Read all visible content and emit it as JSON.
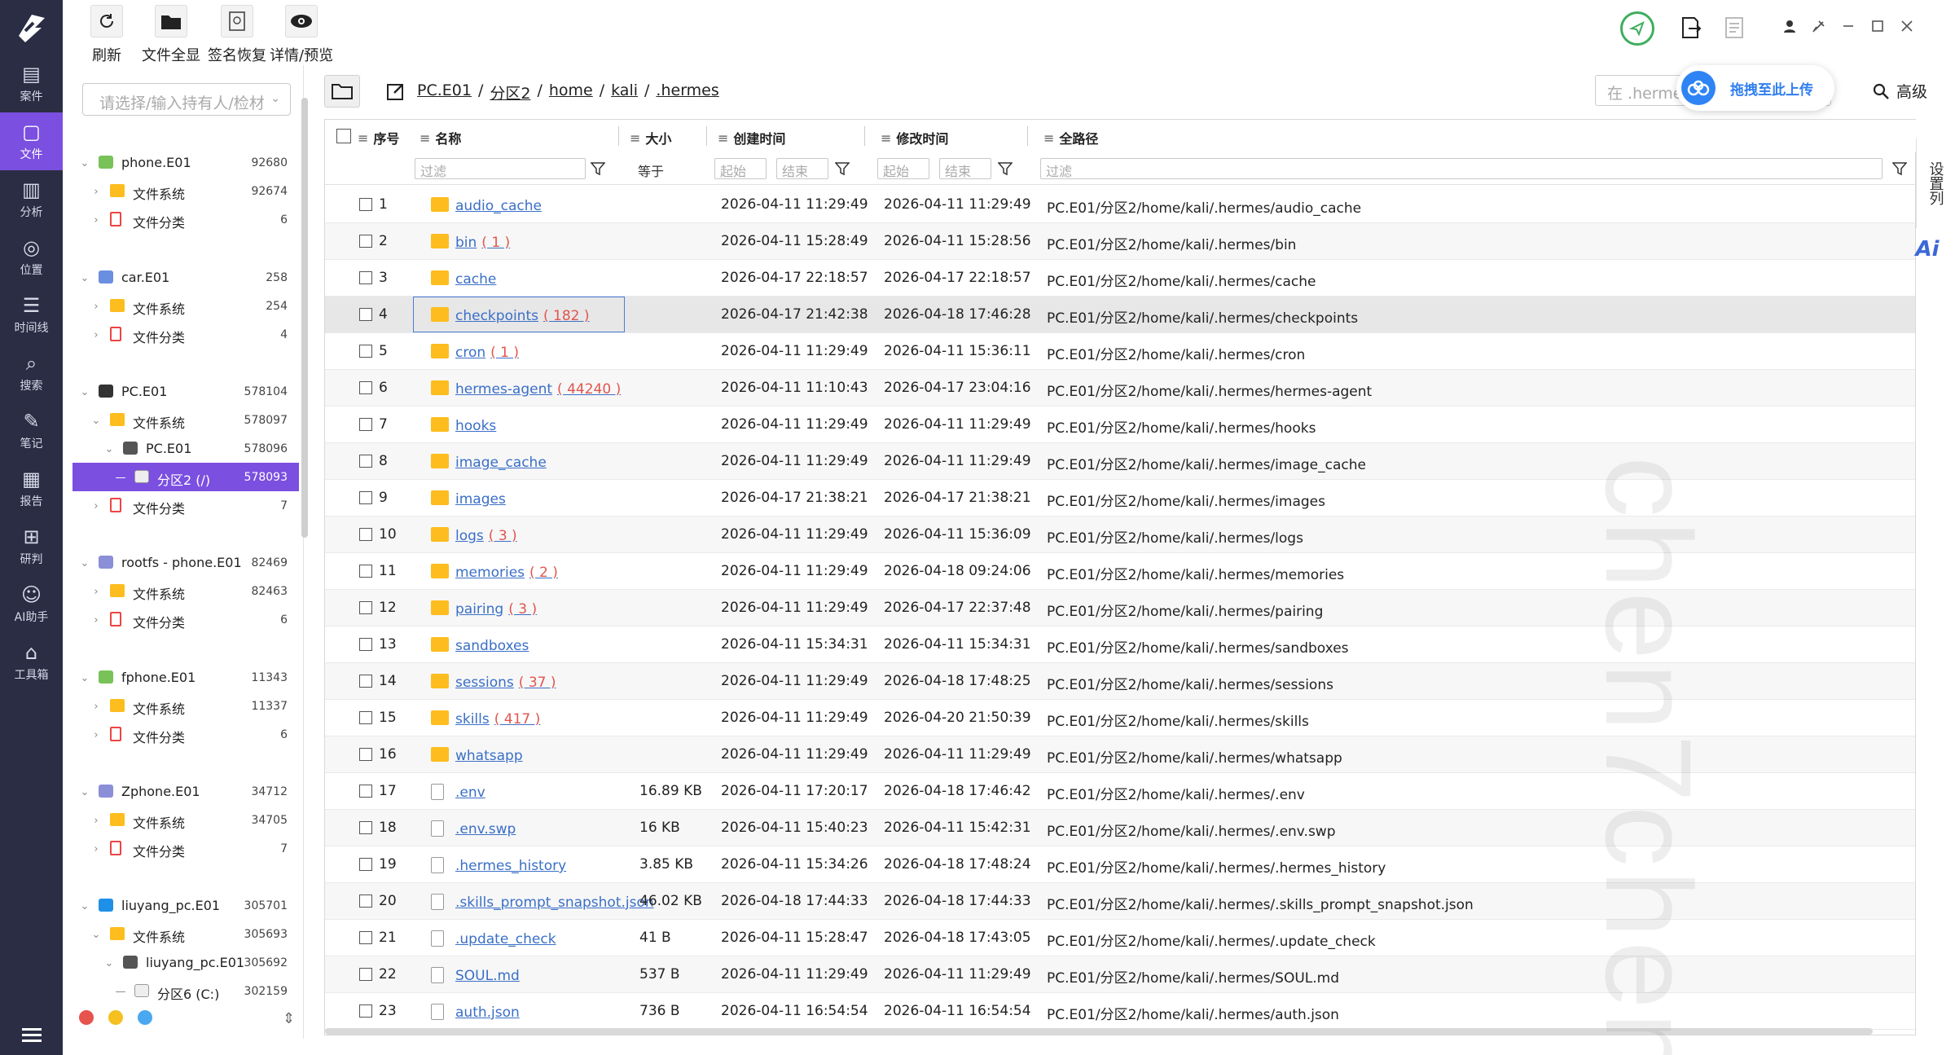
{
  "window_controls": [
    "pin-icon",
    "minimize",
    "maximize",
    "close"
  ],
  "toolbar": {
    "refresh": "刷新",
    "show_all": "文件全显",
    "sign_restore": "签名恢复",
    "detail_preview": "详情/预览"
  },
  "nav": {
    "items": [
      {
        "label": "案件",
        "icon": "case-icon"
      },
      {
        "label": "文件",
        "icon": "file-icon",
        "active": true
      },
      {
        "label": "分析",
        "icon": "analysis-icon"
      },
      {
        "label": "位置",
        "icon": "location-icon"
      },
      {
        "label": "时间线",
        "icon": "timeline-icon"
      },
      {
        "label": "搜索",
        "icon": "search-icon"
      },
      {
        "label": "笔记",
        "icon": "note-icon"
      },
      {
        "label": "报告",
        "icon": "report-icon"
      },
      {
        "label": "研判",
        "icon": "judge-icon"
      },
      {
        "label": "AI助手",
        "icon": "ai-assistant-icon"
      },
      {
        "label": "工具箱",
        "icon": "toolbox-icon"
      }
    ]
  },
  "case_select": {
    "placeholder": "请选择/输入持有人/检材"
  },
  "tree": [
    {
      "label": "phone.E01",
      "count": "92680",
      "level": 0,
      "icon": "android",
      "open": true
    },
    {
      "label": "文件系统",
      "count": "92674",
      "level": 1,
      "icon": "folder"
    },
    {
      "label": "文件分类",
      "count": "6",
      "level": 1,
      "icon": "doc"
    },
    {
      "label": "car.E01",
      "count": "258",
      "level": 0,
      "icon": "car",
      "open": true
    },
    {
      "label": "文件系统",
      "count": "254",
      "level": 1,
      "icon": "folder"
    },
    {
      "label": "文件分类",
      "count": "4",
      "level": 1,
      "icon": "doc"
    },
    {
      "label": "PC.E01",
      "count": "578104",
      "level": 0,
      "icon": "linux",
      "open": true
    },
    {
      "label": "文件系统",
      "count": "578097",
      "level": 1,
      "icon": "folder",
      "open": true
    },
    {
      "label": "PC.E01",
      "count": "578096",
      "level": 2,
      "icon": "disk",
      "open": true
    },
    {
      "label": "分区2 (/)",
      "count": "578093",
      "level": 3,
      "icon": "partition",
      "selected": true
    },
    {
      "label": "文件分类",
      "count": "7",
      "level": 1,
      "icon": "doc"
    },
    {
      "label": "rootfs - phone.E01",
      "count": "82469",
      "level": 0,
      "icon": "rootfs",
      "open": true
    },
    {
      "label": "文件系统",
      "count": "82463",
      "level": 1,
      "icon": "folder"
    },
    {
      "label": "文件分类",
      "count": "6",
      "level": 1,
      "icon": "doc"
    },
    {
      "label": "fphone.E01",
      "count": "11343",
      "level": 0,
      "icon": "android",
      "open": true
    },
    {
      "label": "文件系统",
      "count": "11337",
      "level": 1,
      "icon": "folder"
    },
    {
      "label": "文件分类",
      "count": "6",
      "level": 1,
      "icon": "doc"
    },
    {
      "label": "Zphone.E01",
      "count": "34712",
      "level": 0,
      "icon": "zphone",
      "open": true
    },
    {
      "label": "文件系统",
      "count": "34705",
      "level": 1,
      "icon": "folder"
    },
    {
      "label": "文件分类",
      "count": "7",
      "level": 1,
      "icon": "doc"
    },
    {
      "label": "liuyang_pc.E01",
      "count": "305701",
      "level": 0,
      "icon": "windows",
      "open": true
    },
    {
      "label": "文件系统",
      "count": "305693",
      "level": 1,
      "icon": "folder",
      "open": true
    },
    {
      "label": "liuyang_pc.E01",
      "count": "305692",
      "level": 2,
      "icon": "disk",
      "open": true
    },
    {
      "label": "分区6 (C:)",
      "count": "302159",
      "level": 3,
      "icon": "partition"
    }
  ],
  "path": {
    "segments": [
      "PC.E01",
      "分区2",
      "home",
      "kali",
      ".hermes"
    ],
    "separator": "/"
  },
  "search": {
    "placeholder": "在 .hermes"
  },
  "upload": {
    "label": "拖拽至此上传"
  },
  "advanced": {
    "label": "高级"
  },
  "right_rail": {
    "settings_label": "设置列",
    "ai_label": "Ai"
  },
  "table": {
    "headers": {
      "index": "序号",
      "name": "名称",
      "size": "大小",
      "created": "创建时间",
      "modified": "修改时间",
      "fullpath": "全路径"
    },
    "filters": {
      "name": "过滤",
      "size": "等于",
      "start": "起始",
      "end": "结束",
      "path": "过滤"
    },
    "rows": [
      {
        "no": "1",
        "name": "audio_cache",
        "count": "",
        "type": "folder",
        "size": "",
        "created": "2026-04-11 11:29:49",
        "modified": "2026-04-11 11:29:49",
        "path": "PC.E01/分区2/home/kali/.hermes/audio_cache"
      },
      {
        "no": "2",
        "name": "bin",
        "count": "( 1 )",
        "type": "folder",
        "size": "",
        "created": "2026-04-11 15:28:49",
        "modified": "2026-04-11 15:28:56",
        "path": "PC.E01/分区2/home/kali/.hermes/bin"
      },
      {
        "no": "3",
        "name": "cache",
        "count": "",
        "type": "folder",
        "size": "",
        "created": "2026-04-17 22:18:57",
        "modified": "2026-04-17 22:18:57",
        "path": "PC.E01/分区2/home/kali/.hermes/cache"
      },
      {
        "no": "4",
        "name": "checkpoints",
        "count": "( 182 )",
        "type": "folder",
        "size": "",
        "created": "2026-04-17 21:42:38",
        "modified": "2026-04-18 17:46:28",
        "path": "PC.E01/分区2/home/kali/.hermes/checkpoints",
        "highlight": true
      },
      {
        "no": "5",
        "name": "cron",
        "count": "( 1 )",
        "type": "folder",
        "size": "",
        "created": "2026-04-11 11:29:49",
        "modified": "2026-04-11 15:36:11",
        "path": "PC.E01/分区2/home/kali/.hermes/cron"
      },
      {
        "no": "6",
        "name": "hermes-agent",
        "count": "( 44240 )",
        "type": "folder",
        "size": "",
        "created": "2026-04-11 11:10:43",
        "modified": "2026-04-17 23:04:16",
        "path": "PC.E01/分区2/home/kali/.hermes/hermes-agent"
      },
      {
        "no": "7",
        "name": "hooks",
        "count": "",
        "type": "folder",
        "size": "",
        "created": "2026-04-11 11:29:49",
        "modified": "2026-04-11 11:29:49",
        "path": "PC.E01/分区2/home/kali/.hermes/hooks"
      },
      {
        "no": "8",
        "name": "image_cache",
        "count": "",
        "type": "folder",
        "size": "",
        "created": "2026-04-11 11:29:49",
        "modified": "2026-04-11 11:29:49",
        "path": "PC.E01/分区2/home/kali/.hermes/image_cache"
      },
      {
        "no": "9",
        "name": "images",
        "count": "",
        "type": "folder",
        "size": "",
        "created": "2026-04-17 21:38:21",
        "modified": "2026-04-17 21:38:21",
        "path": "PC.E01/分区2/home/kali/.hermes/images"
      },
      {
        "no": "10",
        "name": "logs",
        "count": "( 3 )",
        "type": "folder",
        "size": "",
        "created": "2026-04-11 11:29:49",
        "modified": "2026-04-11 15:36:09",
        "path": "PC.E01/分区2/home/kali/.hermes/logs"
      },
      {
        "no": "11",
        "name": "memories",
        "count": "( 2 )",
        "type": "folder",
        "size": "",
        "created": "2026-04-11 11:29:49",
        "modified": "2026-04-18 09:24:06",
        "path": "PC.E01/分区2/home/kali/.hermes/memories"
      },
      {
        "no": "12",
        "name": "pairing",
        "count": "( 3 )",
        "type": "folder",
        "size": "",
        "created": "2026-04-11 11:29:49",
        "modified": "2026-04-17 22:37:48",
        "path": "PC.E01/分区2/home/kali/.hermes/pairing"
      },
      {
        "no": "13",
        "name": "sandboxes",
        "count": "",
        "type": "folder",
        "size": "",
        "created": "2026-04-11 15:34:31",
        "modified": "2026-04-11 15:34:31",
        "path": "PC.E01/分区2/home/kali/.hermes/sandboxes"
      },
      {
        "no": "14",
        "name": "sessions",
        "count": "( 37 )",
        "type": "folder",
        "size": "",
        "created": "2026-04-11 11:29:49",
        "modified": "2026-04-18 17:48:25",
        "path": "PC.E01/分区2/home/kali/.hermes/sessions"
      },
      {
        "no": "15",
        "name": "skills",
        "count": "( 417 )",
        "type": "folder",
        "size": "",
        "created": "2026-04-11 11:29:49",
        "modified": "2026-04-20 21:50:39",
        "path": "PC.E01/分区2/home/kali/.hermes/skills"
      },
      {
        "no": "16",
        "name": "whatsapp",
        "count": "",
        "type": "folder",
        "size": "",
        "created": "2026-04-11 11:29:49",
        "modified": "2026-04-11 11:29:49",
        "path": "PC.E01/分区2/home/kali/.hermes/whatsapp"
      },
      {
        "no": "17",
        "name": ".env",
        "count": "",
        "type": "file",
        "size": "16.89 KB",
        "created": "2026-04-11 17:20:17",
        "modified": "2026-04-18 17:46:42",
        "path": "PC.E01/分区2/home/kali/.hermes/.env"
      },
      {
        "no": "18",
        "name": ".env.swp",
        "count": "",
        "type": "file",
        "size": "16 KB",
        "created": "2026-04-11 15:40:23",
        "modified": "2026-04-11 15:42:31",
        "path": "PC.E01/分区2/home/kali/.hermes/.env.swp"
      },
      {
        "no": "19",
        "name": ".hermes_history",
        "count": "",
        "type": "file",
        "size": "3.85 KB",
        "created": "2026-04-11 15:34:26",
        "modified": "2026-04-18 17:48:24",
        "path": "PC.E01/分区2/home/kali/.hermes/.hermes_history"
      },
      {
        "no": "20",
        "name": ".skills_prompt_snapshot.json",
        "count": "",
        "type": "file",
        "size": "46.02 KB",
        "created": "2026-04-18 17:44:33",
        "modified": "2026-04-18 17:44:33",
        "path": "PC.E01/分区2/home/kali/.hermes/.skills_prompt_snapshot.json"
      },
      {
        "no": "21",
        "name": ".update_check",
        "count": "",
        "type": "file",
        "size": "41 B",
        "created": "2026-04-11 15:28:47",
        "modified": "2026-04-18 17:43:05",
        "path": "PC.E01/分区2/home/kali/.hermes/.update_check"
      },
      {
        "no": "22",
        "name": "SOUL.md",
        "count": "",
        "type": "file",
        "size": "537 B",
        "created": "2026-04-11 11:29:49",
        "modified": "2026-04-11 11:29:49",
        "path": "PC.E01/分区2/home/kali/.hermes/SOUL.md"
      },
      {
        "no": "23",
        "name": "auth.json",
        "count": "",
        "type": "file",
        "size": "736 B",
        "created": "2026-04-11 16:54:54",
        "modified": "2026-04-11 16:54:54",
        "path": "PC.E01/分区2/home/kali/.hermes/auth.json"
      }
    ]
  },
  "watermark": "chen7chen",
  "colors": {
    "nav_bg": "#2a2d44",
    "accent": "#7b4fe0",
    "folder": "#fdbd1f",
    "link": "#3a6fc7",
    "count_red": "#e0554e",
    "upload_blue": "#2f84f5"
  }
}
